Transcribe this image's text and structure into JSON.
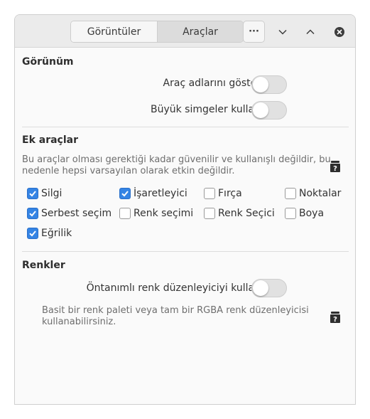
{
  "header": {
    "tabs": [
      {
        "label": "Görüntüler",
        "active": false
      },
      {
        "label": "Araçlar",
        "active": true
      }
    ],
    "menu_label": "···"
  },
  "appearance": {
    "title": "Görünüm",
    "toggles": [
      {
        "label": "Araç adlarını göster",
        "on": false
      },
      {
        "label": "Büyük simgeler kullan",
        "on": false
      }
    ]
  },
  "extra_tools": {
    "title": "Ek araçlar",
    "description_line1": "Bu araçlar olması gerektiği kadar güvenilir ve kullanışlı değildir, bu",
    "description_line2": "nedenle hepsi varsayılan olarak etkin değildir.",
    "items": [
      {
        "label": "Silgi",
        "checked": true
      },
      {
        "label": "İşaretleyici",
        "checked": true
      },
      {
        "label": "Fırça",
        "checked": false
      },
      {
        "label": "Noktalar",
        "checked": false
      },
      {
        "label": "Serbest seçim",
        "checked": true
      },
      {
        "label": "Renk seçimi",
        "checked": false
      },
      {
        "label": "Renk Seçici",
        "checked": false
      },
      {
        "label": "Boya",
        "checked": false
      },
      {
        "label": "Eğrilik",
        "checked": true
      }
    ]
  },
  "colors": {
    "title": "Renkler",
    "toggle_label": "Öntanımlı renk düzenleyiciyi kullan",
    "toggle_on": false,
    "description_line1": "Basit bir renk paleti veya tam bir RGBA renk düzenleyicisi",
    "description_line2": "kullanabilirsiniz."
  },
  "accent_color": "#3584e4"
}
